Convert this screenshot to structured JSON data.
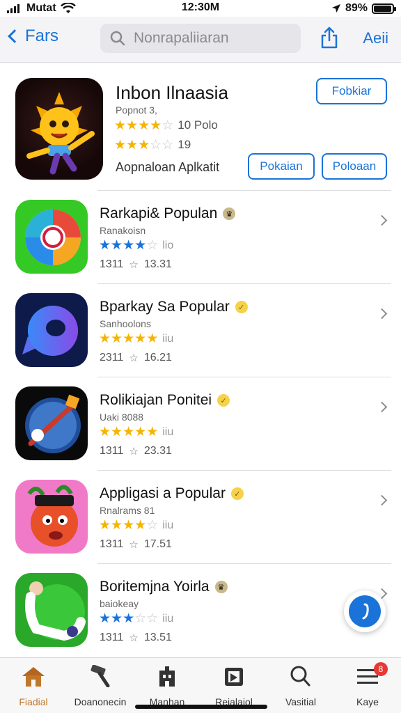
{
  "status_bar": {
    "carrier": "Mutat",
    "time": "12:30M",
    "battery_percent": "89%",
    "battery_level": 0.89
  },
  "nav": {
    "back_label": "Fars",
    "search_placeholder": "Nonrapaliiaran",
    "right_label": "Aeii"
  },
  "featured": {
    "title": "Inbon Ilnaasia",
    "subtitle": "Popnot 3,",
    "rating_primary": {
      "stars": 4.5,
      "text": "10 Polo"
    },
    "rating_secondary": {
      "stars": 3.5,
      "text": "19"
    },
    "caption": "Aopnaloan Aplkatit",
    "btn_top": "Fobkiar",
    "btn_left": "Pokaian",
    "btn_right": "Poloaan"
  },
  "apps": [
    {
      "title": "Rarkapi& Populan",
      "badge": "crown",
      "subtitle": "Ranakoisn",
      "stars": 4.5,
      "star_color": "blue",
      "rating_text": "lio",
      "count": "1311",
      "size": "13.31",
      "icon": "camera-ring-icon"
    },
    {
      "title": "Bparkay Sa Popular",
      "badge": "verified",
      "subtitle": "Sanhoolons",
      "stars": 5,
      "star_color": "gold",
      "rating_text": "iiu",
      "count": "2311",
      "size": "16.21",
      "icon": "chat-bubble-icon"
    },
    {
      "title": "Rolikiajan Ponitei",
      "badge": "verified",
      "subtitle": "Uaki 8088",
      "stars": 5,
      "star_color": "gold",
      "rating_text": "iiu",
      "count": "1311",
      "size": "23.31",
      "icon": "compass-icon"
    },
    {
      "title": "Appligasi a Popular",
      "badge": "verified",
      "subtitle": "Rnalrams 81",
      "stars": 4.5,
      "star_color": "gold",
      "rating_text": "iiu",
      "count": "1311",
      "size": "17.51",
      "icon": "cartoon-face-icon"
    },
    {
      "title": "Boritemjna Yoirla",
      "badge": "crown",
      "subtitle": "baiokeay",
      "stars": 3.5,
      "star_color": "blue",
      "rating_text": "iiu",
      "count": "1311",
      "size": "13.51",
      "icon": "character-icon"
    }
  ],
  "tabs": [
    {
      "label": "Fiadial",
      "icon": "home-icon",
      "active": true
    },
    {
      "label": "Doanonecin",
      "icon": "hammer-icon",
      "active": false
    },
    {
      "label": "Manhan",
      "icon": "building-icon",
      "active": false
    },
    {
      "label": "Rejalaiol",
      "icon": "layers-icon",
      "active": false
    },
    {
      "label": "Vasitial",
      "icon": "search-icon",
      "active": false
    },
    {
      "label": "Kaye",
      "icon": "menu-icon",
      "active": false,
      "badge": "8"
    }
  ],
  "colors": {
    "accent": "#1a73d8",
    "star_gold": "#f5b400",
    "tab_active": "#c0772a",
    "badge_red": "#e53935"
  }
}
